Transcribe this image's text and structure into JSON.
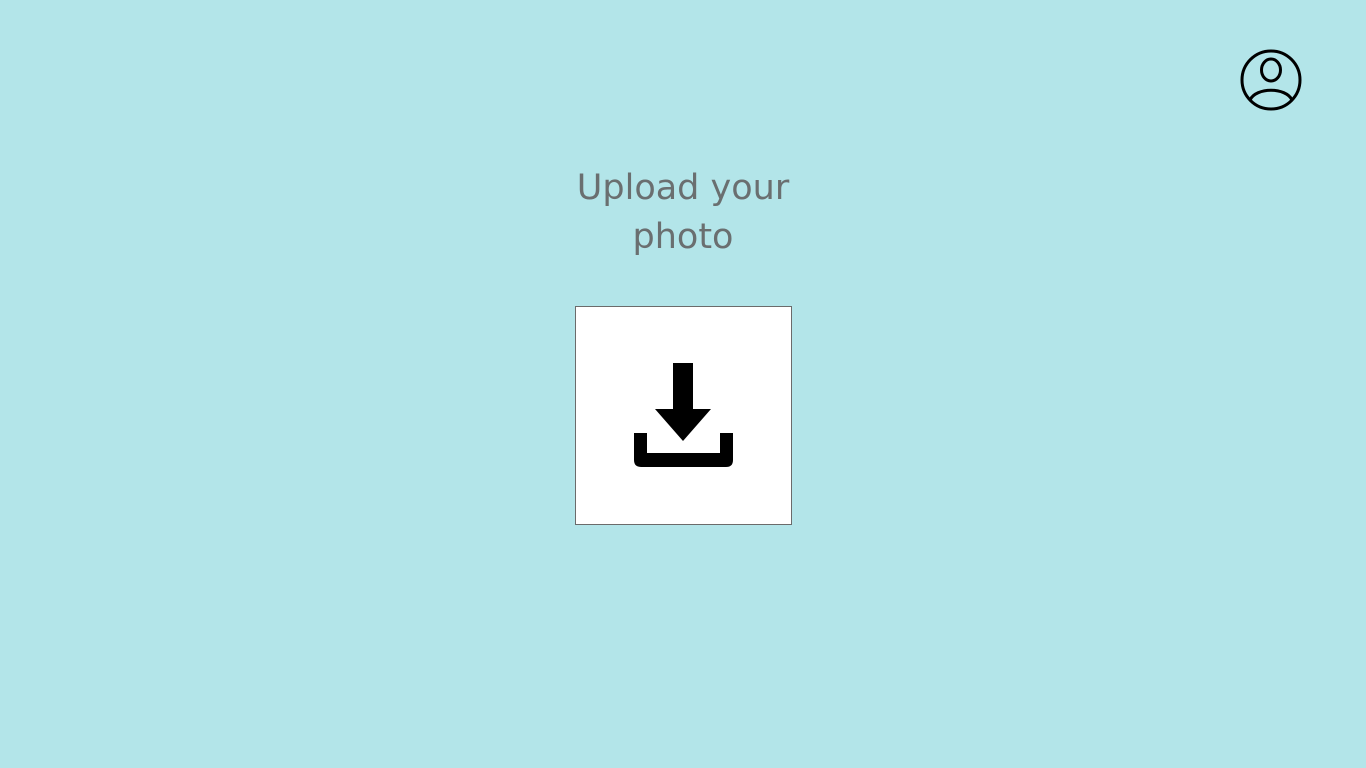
{
  "header": {
    "profile_icon": "user-circle-icon"
  },
  "main": {
    "title_line1": "Upload your",
    "title_line2": "photo",
    "upload_icon": "download-tray-icon"
  },
  "colors": {
    "background": "#b3e5e9",
    "title_text": "#6a6f70",
    "upload_box": "#ffffff",
    "icon": "#000000"
  }
}
